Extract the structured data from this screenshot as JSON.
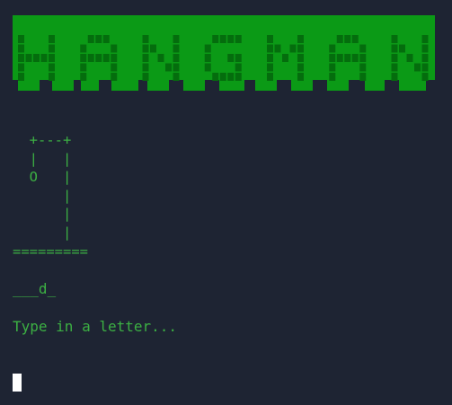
{
  "colors": {
    "background": "#1e2433",
    "text": "#3cb043",
    "banner_bright": "#0b9a16",
    "banner_dark": "#046d0d",
    "cursor": "#ffffff"
  },
  "banner": {
    "text": "HANGMAN"
  },
  "gallows": {
    "lines": [
      "  +---+",
      "  |   |",
      "  O   |",
      "      |",
      "      |",
      "      |",
      "========="
    ]
  },
  "word": {
    "display": "___d_"
  },
  "prompt": {
    "text": "Type in a letter..."
  }
}
